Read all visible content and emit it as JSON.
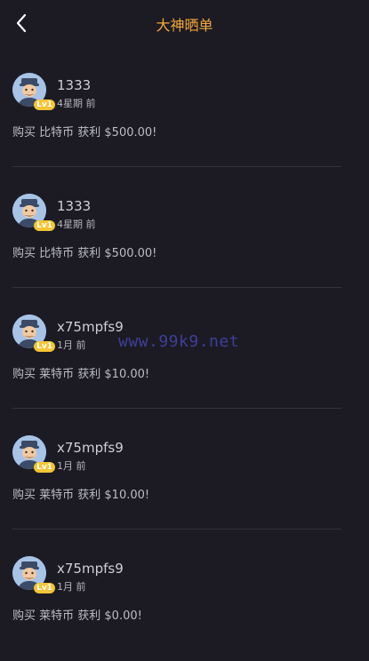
{
  "header": {
    "title": "大神晒单"
  },
  "colors": {
    "accent": "#f3a73a",
    "background": "#1c1b24",
    "badge": "#f4c535"
  },
  "posts": [
    {
      "user": "1333",
      "badge": "Lv1",
      "time": "4星期 前",
      "text": "购买 比特币 获利 $500.00!"
    },
    {
      "user": "1333",
      "badge": "Lv1",
      "time": "4星期 前",
      "text": "购买 比特币 获利 $500.00!"
    },
    {
      "user": "x75mpfs9",
      "badge": "Lv1",
      "time": "1月 前",
      "text": "购买 莱特币 获利 $10.00!"
    },
    {
      "user": "x75mpfs9",
      "badge": "Lv1",
      "time": "1月 前",
      "text": "购买 莱特币 获利 $10.00!"
    },
    {
      "user": "x75mpfs9",
      "badge": "Lv1",
      "time": "1月 前",
      "text": "购买 莱特币 获利 $0.00!"
    }
  ],
  "watermark": "www.99k9.net"
}
